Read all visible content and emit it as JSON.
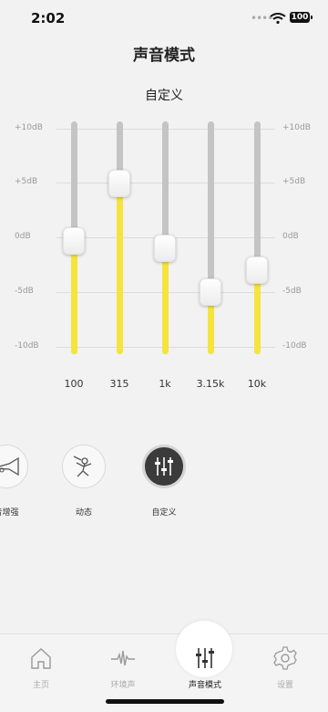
{
  "status_bar": {
    "time": "2:02",
    "battery": "100"
  },
  "header": {
    "title": "声音模式"
  },
  "preset": {
    "name": "自定义"
  },
  "equalizer": {
    "db_labels": [
      "+10dB",
      "+5dB",
      "0dB",
      "-5dB",
      "-10dB"
    ],
    "bands": [
      {
        "freq": "100",
        "db": -0.3
      },
      {
        "freq": "315",
        "db": 5
      },
      {
        "freq": "1k",
        "db": -1
      },
      {
        "freq": "3.15k",
        "db": -5
      },
      {
        "freq": "10k",
        "db": -3
      }
    ]
  },
  "modes": [
    {
      "label": "音增强",
      "icon": "trumpet-icon"
    },
    {
      "label": "动态",
      "icon": "dancer-icon"
    },
    {
      "label": "自定义",
      "icon": "equalizer-icon",
      "selected": true
    }
  ],
  "tabs": [
    {
      "label": "主页",
      "icon": "home-icon"
    },
    {
      "label": "环境声",
      "icon": "waveform-icon"
    },
    {
      "label": "声音模式",
      "icon": "sliders-icon",
      "active": true
    },
    {
      "label": "设置",
      "icon": "gear-icon"
    }
  ],
  "colors": {
    "accent": "#f5e43d",
    "track": "#c4c4c4",
    "background": "#f2f2f2"
  }
}
